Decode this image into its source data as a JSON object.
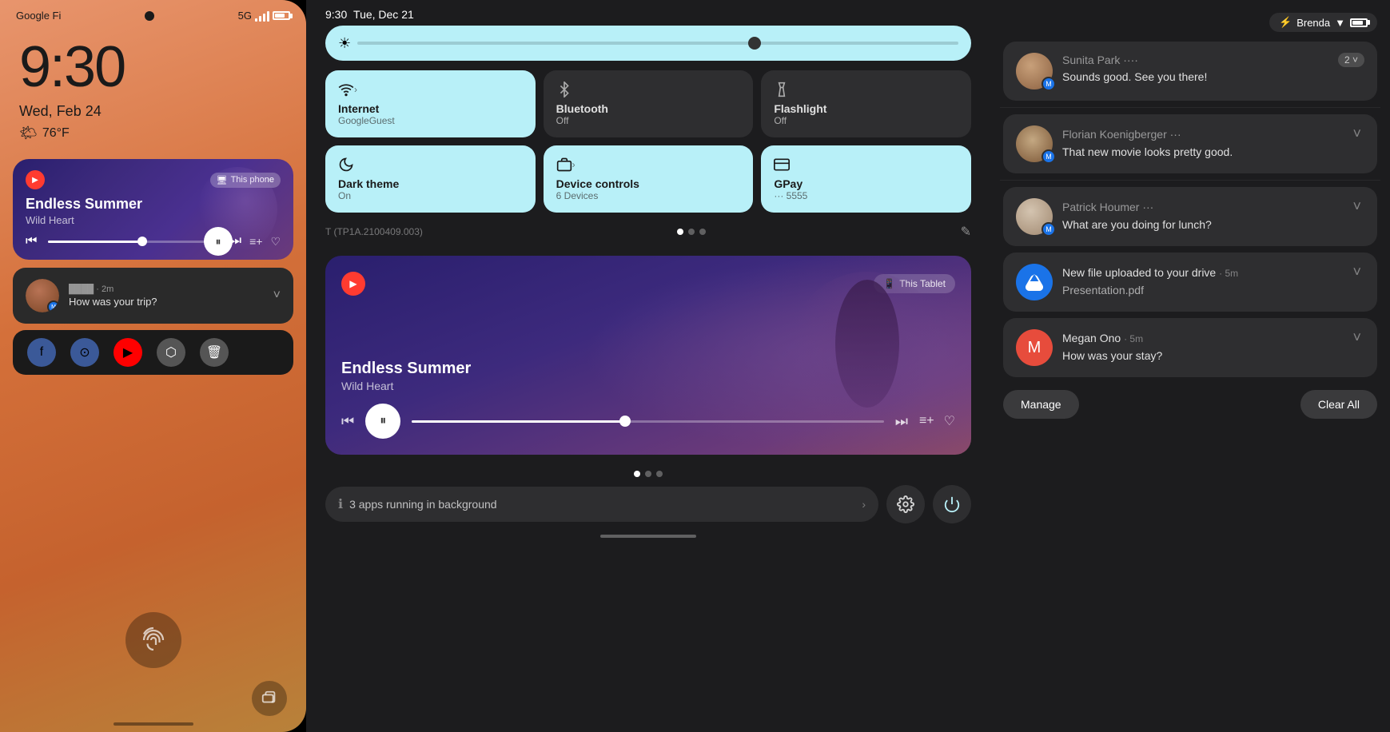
{
  "phone": {
    "carrier": "Google Fi",
    "network": "5G",
    "time": "9:30",
    "date": "Wed, Feb 24",
    "weather": "76°F",
    "weather_icon": "🌤",
    "music": {
      "title": "Endless Summer",
      "artist": "Wild Heart",
      "badge": "This phone",
      "badge_icon": "🖥",
      "play_icon": "⏸"
    },
    "notification": {
      "message": "How was your trip?",
      "time": "2m"
    }
  },
  "tablet": {
    "time": "9:30",
    "date": "Tue, Dec 21",
    "brightness_pct": 70,
    "tiles": [
      {
        "label": "Internet",
        "sublabel": "GoogleGuest",
        "icon": "wifi",
        "active": true
      },
      {
        "label": "Bluetooth",
        "sublabel": "Off",
        "icon": "bluetooth",
        "active": false
      },
      {
        "label": "Flashlight",
        "sublabel": "Off",
        "icon": "flashlight",
        "active": false
      },
      {
        "label": "Dark theme",
        "sublabel": "On",
        "icon": "theme",
        "active": true
      },
      {
        "label": "Device controls",
        "sublabel": "6 Devices",
        "icon": "devices",
        "active": true
      },
      {
        "label": "GPay",
        "sublabel": "··· 5555",
        "icon": "pay",
        "active": true
      }
    ],
    "device_info": "T (TP1A.2100409.003)",
    "music": {
      "title": "Endless Summer",
      "artist": "Wild Heart",
      "badge": "This Tablet"
    },
    "running_apps": "3 apps running in background"
  },
  "notifications": {
    "status_label": "Brenda",
    "items": [
      {
        "name": "Sunita Park",
        "message": "Sounds good. See you there!",
        "badge_count": "2",
        "has_badge": true,
        "type": "messenger"
      },
      {
        "name": "Florian Koenigberger",
        "message": "That new movie looks pretty good.",
        "has_badge": false,
        "type": "messenger"
      },
      {
        "name": "Patrick Houmer",
        "message": "What are you doing for lunch?",
        "has_badge": false,
        "type": "messenger"
      },
      {
        "name": "New file uploaded to your drive",
        "message": "Presentation.pdf",
        "time": "5m",
        "has_badge": false,
        "type": "drive"
      },
      {
        "name": "Megan Ono",
        "message": "How was your stay?",
        "time": "5m",
        "has_badge": false,
        "type": "messenger"
      }
    ],
    "manage_label": "Manage",
    "clear_all_label": "Clear All"
  }
}
